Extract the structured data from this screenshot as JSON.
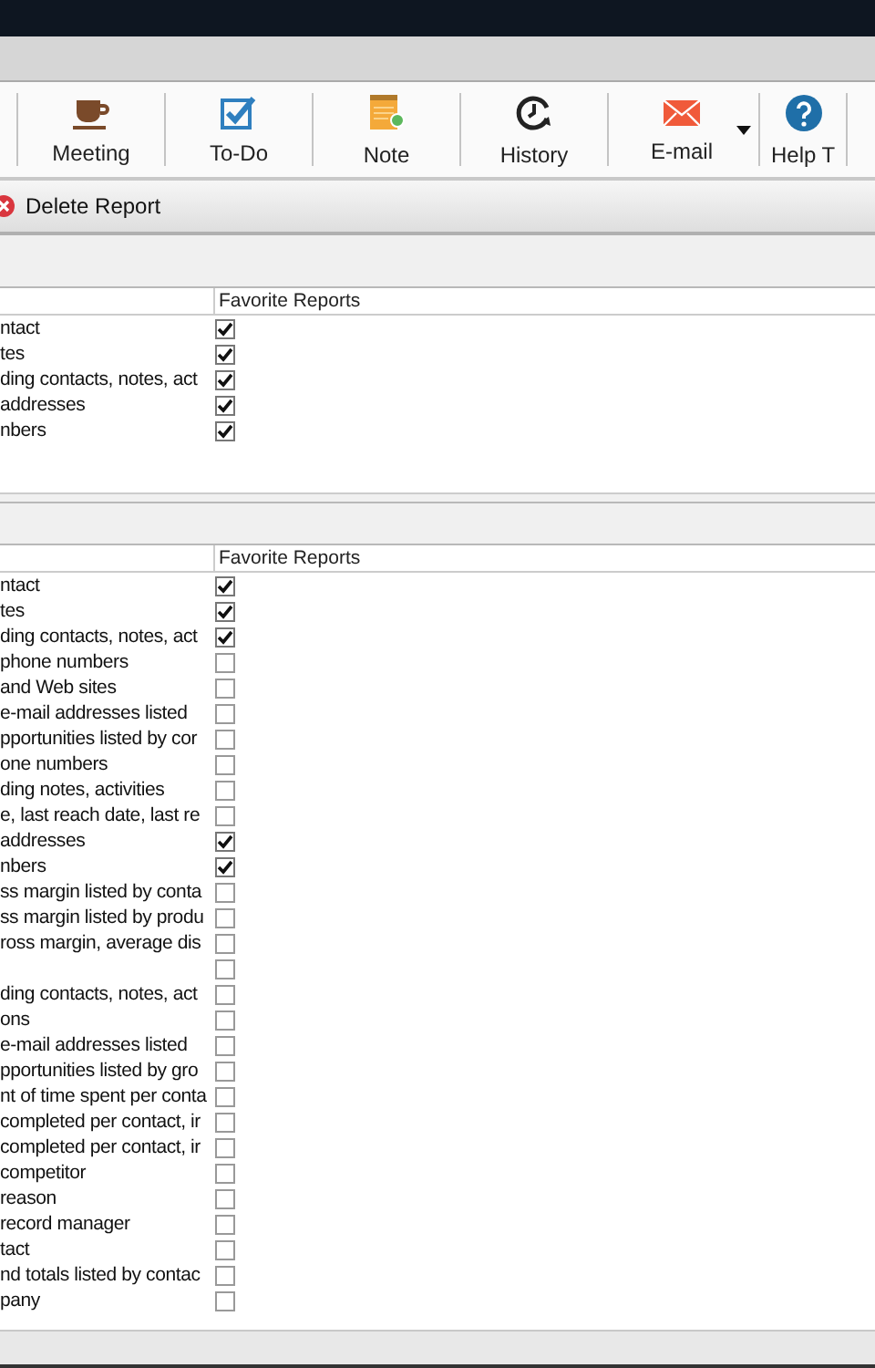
{
  "toolbar": [
    {
      "label": "Meeting",
      "kind": "cup",
      "dropdown": false
    },
    {
      "label": "To-Do",
      "kind": "todo",
      "dropdown": false
    },
    {
      "label": "Note",
      "kind": "note",
      "dropdown": false
    },
    {
      "label": "History",
      "kind": "history",
      "dropdown": false
    },
    {
      "label": "E-mail",
      "kind": "mail",
      "dropdown": true
    },
    {
      "label": "Help T",
      "kind": "help",
      "dropdown": false
    }
  ],
  "action_bar": {
    "label": "Delete Report"
  },
  "favorites_table": {
    "columns": [
      "Favorite Reports"
    ],
    "rows": [
      {
        "name": "ntact",
        "checked": true
      },
      {
        "name": "tes",
        "checked": true
      },
      {
        "name": "ding contacts, notes, act",
        "checked": true
      },
      {
        "name": "addresses",
        "checked": true
      },
      {
        "name": "nbers",
        "checked": true
      }
    ]
  },
  "all_reports_table": {
    "columns": [
      "Favorite Reports"
    ],
    "rows": [
      {
        "name": "ntact",
        "checked": true
      },
      {
        "name": "tes",
        "checked": true
      },
      {
        "name": "ding contacts, notes, act",
        "checked": true
      },
      {
        "name": "phone numbers",
        "checked": false
      },
      {
        "name": "and Web sites",
        "checked": false
      },
      {
        "name": "e-mail addresses listed",
        "checked": false
      },
      {
        "name": "pportunities listed by cor",
        "checked": false
      },
      {
        "name": "one numbers",
        "checked": false
      },
      {
        "name": "ding notes, activities",
        "checked": false
      },
      {
        "name": "e, last reach date, last re",
        "checked": false
      },
      {
        "name": "addresses",
        "checked": true
      },
      {
        "name": "nbers",
        "checked": true
      },
      {
        "name": "ss margin listed by conta",
        "checked": false
      },
      {
        "name": "ss margin listed by produ",
        "checked": false
      },
      {
        "name": "ross margin, average dis",
        "checked": false
      },
      {
        "name": "",
        "checked": false
      },
      {
        "name": "ding contacts, notes, act",
        "checked": false
      },
      {
        "name": "ons",
        "checked": false
      },
      {
        "name": "e-mail addresses listed",
        "checked": false
      },
      {
        "name": "pportunities listed by gro",
        "checked": false
      },
      {
        "name": "nt of time spent per conta",
        "checked": false
      },
      {
        "name": "completed per contact, ir",
        "checked": false
      },
      {
        "name": "completed per contact, ir",
        "checked": false
      },
      {
        "name": "competitor",
        "checked": false
      },
      {
        "name": "reason",
        "checked": false
      },
      {
        "name": "record manager",
        "checked": false
      },
      {
        "name": "tact",
        "checked": false
      },
      {
        "name": "nd totals listed by contac",
        "checked": false
      },
      {
        "name": "pany",
        "checked": false
      }
    ]
  }
}
